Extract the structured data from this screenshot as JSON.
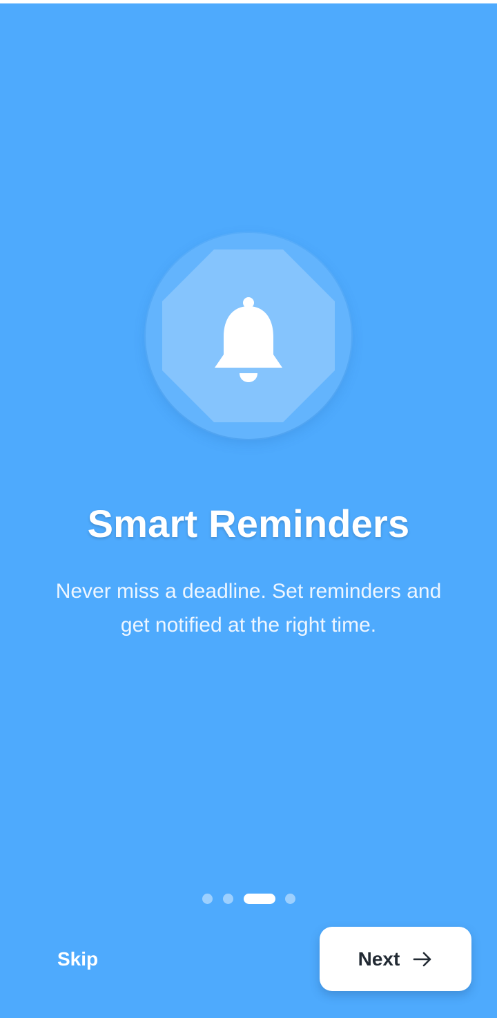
{
  "onboarding": {
    "title": "Smart Reminders",
    "subtitle": "Never miss a deadline. Set reminders and get notified at the right time.",
    "hero_icon": "bell-icon",
    "pager": {
      "total_pages": 4,
      "current_page": 3
    }
  },
  "actions": {
    "skip_label": "Skip",
    "next_label": "Next",
    "next_icon": "arrow-right-icon"
  },
  "colors": {
    "background": "#4eaafd",
    "button_background": "#ffffff",
    "button_text": "#222a33",
    "text": "#ffffff"
  }
}
